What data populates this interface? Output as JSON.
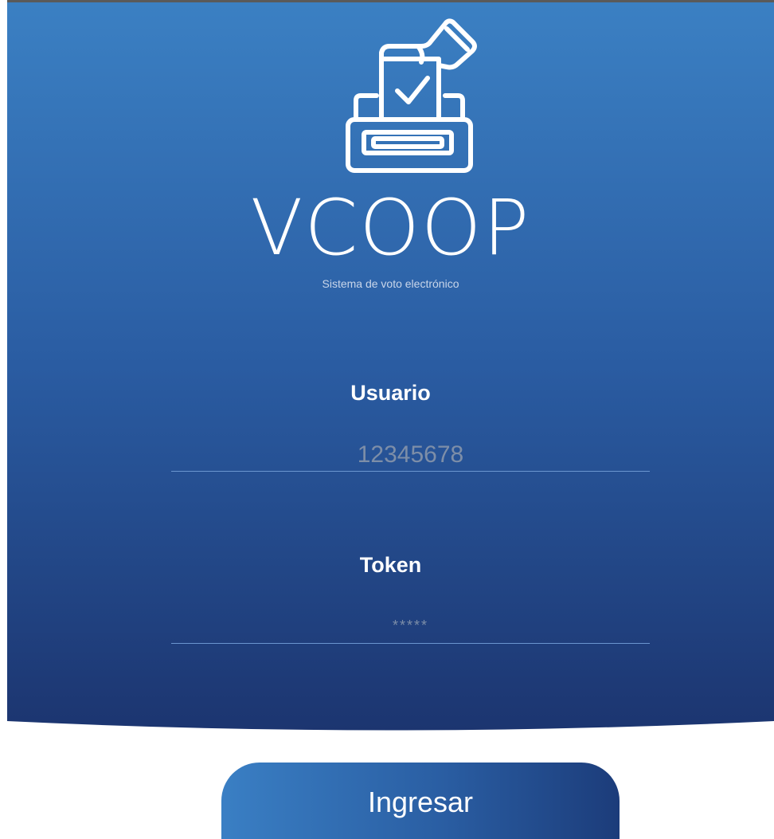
{
  "brand": {
    "name": "VCOOP",
    "tagline": "Sistema de voto electrónico",
    "logo_icon": "ballot-box-icon"
  },
  "form": {
    "user": {
      "label": "Usuario",
      "placeholder": "12345678",
      "value": ""
    },
    "token": {
      "label": "Token",
      "placeholder": "*****",
      "value": ""
    },
    "submit_label": "Ingresar"
  },
  "colors": {
    "hero_top": "#3b80c3",
    "hero_bottom": "#1c3570",
    "button_left": "#3a7fc4",
    "button_right": "#1c3c7a",
    "text": "#ffffff"
  }
}
